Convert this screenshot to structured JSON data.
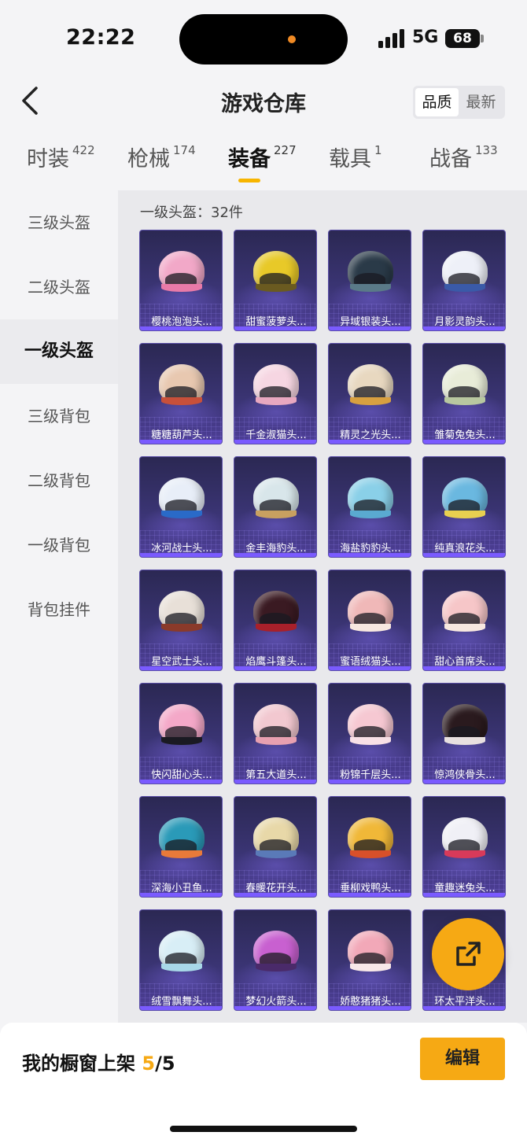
{
  "status": {
    "time": "22:22",
    "network": "5G",
    "battery": "68"
  },
  "nav": {
    "title": "游戏仓库",
    "sort": [
      "品质",
      "最新"
    ]
  },
  "tabs": [
    {
      "label": "时装",
      "count": "422"
    },
    {
      "label": "枪械",
      "count": "174"
    },
    {
      "label": "装备",
      "count": "227"
    },
    {
      "label": "载具",
      "count": "1"
    },
    {
      "label": "战备",
      "count": "133"
    }
  ],
  "sidebar": [
    "三级头盔",
    "二级头盔",
    "一级头盔",
    "三级背包",
    "二级背包",
    "一级背包",
    "背包挂件"
  ],
  "section": {
    "title": "一级头盔：32件"
  },
  "items": [
    {
      "name": "樱桃泡泡头...",
      "color": "#f2a8c8",
      "rim": "#e87aa8"
    },
    {
      "name": "甜蜜菠萝头...",
      "color": "#e8c928",
      "rim": "#6a5a20"
    },
    {
      "name": "异域银装头...",
      "color": "#2a3a48",
      "rim": "#5a7a88"
    },
    {
      "name": "月影灵韵头...",
      "color": "#eef0f8",
      "rim": "#3a5aa8"
    },
    {
      "name": "糖糖葫芦头...",
      "color": "#e8c8b0",
      "rim": "#c8503a"
    },
    {
      "name": "千金淑猫头...",
      "color": "#f6d6e2",
      "rim": "#e8a8c0"
    },
    {
      "name": "精灵之光头...",
      "color": "#e8d8c0",
      "rim": "#d8a040"
    },
    {
      "name": "雏菊兔兔头...",
      "color": "#e8ecd8",
      "rim": "#b8c8a0"
    },
    {
      "name": "冰河战士头...",
      "color": "#e8eef8",
      "rim": "#2a6ac8"
    },
    {
      "name": "金丰海豹头...",
      "color": "#d8e6ea",
      "rim": "#c8a060"
    },
    {
      "name": "海盐豹豹头...",
      "color": "#8ad0e8",
      "rim": "#5aaad0"
    },
    {
      "name": "纯真浪花头...",
      "color": "#6ab8e0",
      "rim": "#e8d050"
    },
    {
      "name": "星空武士头...",
      "color": "#e8e0d8",
      "rim": "#8a3a2a"
    },
    {
      "name": "焰鹰斗篷头...",
      "color": "#3a1a22",
      "rim": "#a8202a"
    },
    {
      "name": "蜜语绒猫头...",
      "color": "#f0b8b8",
      "rim": "#f8e8e0"
    },
    {
      "name": "甜心首席头...",
      "color": "#f6c6c8",
      "rim": "#f8e8e0"
    },
    {
      "name": "快闪甜心头...",
      "color": "#f4a8c8",
      "rim": "#1a1a22"
    },
    {
      "name": "第五大道头...",
      "color": "#f2c8d0",
      "rim": "#e8a0b0"
    },
    {
      "name": "粉锦千层头...",
      "color": "#f6c8d2",
      "rim": "#f8e0e6"
    },
    {
      "name": "惊鸿侠骨头...",
      "color": "#2a1a1e",
      "rim": "#e8e0e0"
    },
    {
      "name": "深海小丑鱼...",
      "color": "#2a9ab8",
      "rim": "#e87a3a"
    },
    {
      "name": "春暖花开头...",
      "color": "#e8d8a8",
      "rim": "#5a7ab8"
    },
    {
      "name": "垂柳戏鸭头...",
      "color": "#f0b838",
      "rim": "#d8502a"
    },
    {
      "name": "童趣迷兔头...",
      "color": "#f0f0f6",
      "rim": "#d83a5a"
    },
    {
      "name": "绒雪飘舞头...",
      "color": "#d8eef6",
      "rim": "#a8d8e8"
    },
    {
      "name": "梦幻火箭头...",
      "color": "#c860d0",
      "rim": "#4a2a6a"
    },
    {
      "name": "娇憨猪猪头...",
      "color": "#f2a8b8",
      "rim": "#f8e8e8"
    },
    {
      "name": "环太平洋头...",
      "color": "#c8c8d0",
      "rim": "#6a6a78"
    }
  ],
  "bottom": {
    "label": "我的橱窗上架",
    "count": "5",
    "total": "/5",
    "edit": "编辑"
  }
}
